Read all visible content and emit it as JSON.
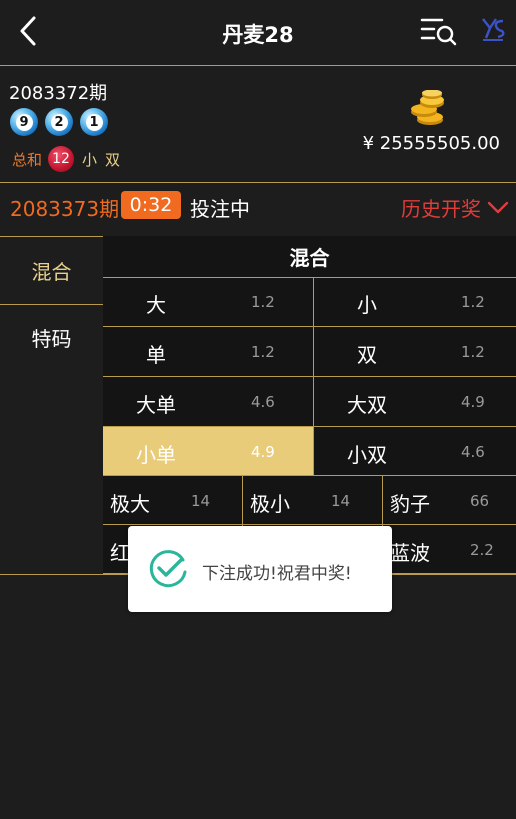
{
  "header": {
    "title": "丹麦28",
    "back_icon": "chevron-left-icon",
    "menu_icon": "list-search-icon",
    "logo_icon": "brand-logo-icon"
  },
  "last_draw": {
    "period": "2083372期",
    "balls": [
      "9",
      "2",
      "1"
    ],
    "sum_label": "总和",
    "sum_value": "12",
    "size_tag": "小",
    "parity_tag": "双"
  },
  "wallet": {
    "icon": "coins-icon",
    "balance": "¥ 25555505.00"
  },
  "current": {
    "period": "2083373期",
    "countdown": "0:32",
    "status": "投注中",
    "history_label": "历史开奖",
    "history_icon": "chevron-down-icon"
  },
  "tabs": [
    {
      "label": "混合",
      "active": true
    },
    {
      "label": "特码",
      "active": false
    }
  ],
  "panel": {
    "title": "混合",
    "rows_2col": [
      [
        {
          "name": "大",
          "odds": "1.2"
        },
        {
          "name": "小",
          "odds": "1.2"
        }
      ],
      [
        {
          "name": "单",
          "odds": "1.2"
        },
        {
          "name": "双",
          "odds": "1.2"
        }
      ],
      [
        {
          "name": "大单",
          "odds": "4.6"
        },
        {
          "name": "大双",
          "odds": "4.9"
        }
      ],
      [
        {
          "name": "小单",
          "odds": "4.9",
          "selected": true
        },
        {
          "name": "小双",
          "odds": "4.6"
        }
      ]
    ],
    "rows_3col": [
      [
        {
          "name": "极大",
          "odds": "14"
        },
        {
          "name": "极小",
          "odds": "14"
        },
        {
          "name": "豹子",
          "odds": "66"
        }
      ],
      [
        {
          "name": "红",
          "odds": ""
        },
        {
          "name": "",
          "odds": ""
        },
        {
          "name": "蓝波",
          "odds": "2.2"
        }
      ]
    ]
  },
  "toast": {
    "icon": "check-circle-icon",
    "message": "下注成功!祝君中奖!"
  },
  "colors": {
    "background": "#1d1d1d",
    "gold_line": "#b99b4e",
    "accent_orange": "#f06a1f",
    "history_red": "#e03c3a",
    "selected_gold": "#e9cc7a"
  }
}
